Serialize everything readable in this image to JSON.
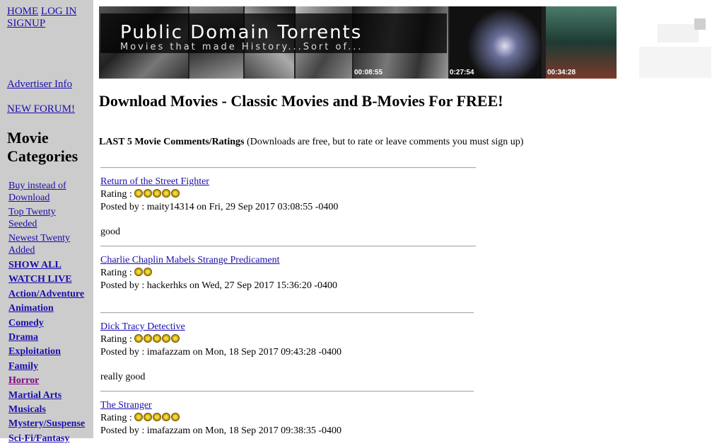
{
  "sidebar": {
    "top_links": [
      "HOME",
      "LOG IN",
      "SIGNUP"
    ],
    "advertiser": "Advertiser Info",
    "forum": "NEW FORUM!",
    "heading": "Movie Categories",
    "categories": [
      "Buy instead of Download",
      "Top Twenty Seeded",
      "Newest Twenty Added",
      "SHOW ALL",
      "WATCH LIVE",
      "Action/Adventure",
      "Animation",
      "Comedy",
      "Drama",
      "Exploitation",
      "Family",
      "Horror",
      "Martial Arts",
      "Musicals",
      "Mystery/Suspense",
      "Sci-Fi/Fantasy"
    ]
  },
  "banner": {
    "title": "Public Domain Torrents",
    "subtitle": "Movies that made History...Sort of...",
    "timecodes": [
      "00:08:55",
      "0:27:54",
      "00:34:28"
    ]
  },
  "main": {
    "heading": "Download Movies - Classic Movies and B-Movies For FREE!",
    "intro_bold": "LAST 5 Movie Comments/Ratings",
    "intro_rest": " (Downloads are free, but to rate or leave comments you must sign up)"
  },
  "comments": [
    {
      "title": "Return of the Street Fighter",
      "rating_label": "Rating :",
      "rating": 5,
      "posted": "Posted by : maity14314 on Fri, 29 Sep 2017 03:08:55 -0400",
      "text": "good"
    },
    {
      "title": "Charlie Chaplin Mabels Strange Predicament",
      "rating_label": "Rating :",
      "rating": 2,
      "posted": "Posted by : hackerhks on Wed, 27 Sep 2017 15:36:20 -0400",
      "text": ""
    },
    {
      "title": "Dick Tracy Detective",
      "rating_label": "Rating :",
      "rating": 5,
      "posted": "Posted by : imafazzam on Mon, 18 Sep 2017 09:43:28 -0400",
      "text": "really good"
    },
    {
      "title": "The Stranger",
      "rating_label": "Rating :",
      "rating": 5,
      "posted": "Posted by : imafazzam on Mon, 18 Sep 2017 09:38:35 -0400",
      "text": ""
    }
  ]
}
